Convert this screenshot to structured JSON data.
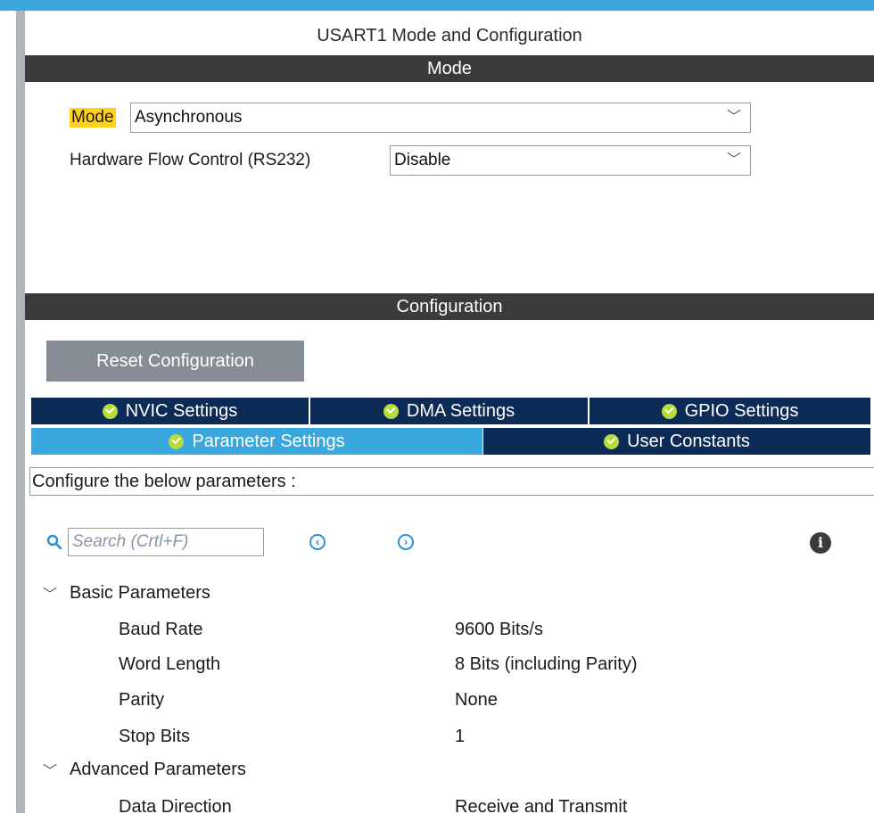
{
  "header": {
    "title": "USART1 Mode and Configuration"
  },
  "mode_section": {
    "title": "Mode",
    "mode": {
      "label": "Mode",
      "value": "Asynchronous"
    },
    "hw_flow": {
      "label": "Hardware Flow Control (RS232)",
      "value": "Disable"
    }
  },
  "config_section": {
    "title": "Configuration",
    "reset_label": "Reset Configuration",
    "tabs_row1": [
      "NVIC Settings",
      "DMA Settings",
      "GPIO Settings"
    ],
    "tabs_row2": [
      "Parameter Settings",
      "User Constants"
    ],
    "active_tab": "Parameter Settings",
    "description": "Configure the below parameters :",
    "search_placeholder": "Search (Crtl+F)",
    "groups": [
      {
        "name": "Basic Parameters",
        "params": [
          {
            "name": "Baud Rate",
            "value": "9600 Bits/s"
          },
          {
            "name": "Word Length",
            "value": "8 Bits (including Parity)"
          },
          {
            "name": "Parity",
            "value": "None"
          },
          {
            "name": "Stop Bits",
            "value": "1"
          }
        ]
      },
      {
        "name": "Advanced Parameters",
        "params": [
          {
            "name": "Data Direction",
            "value": "Receive and Transmit"
          }
        ]
      }
    ]
  },
  "colors": {
    "accent_blue": "#3aa8de",
    "tab_dark": "#0d2b57",
    "section_bar": "#3b3b3b",
    "highlight": "#ffd11a",
    "check_green": "#b6dc3a"
  }
}
